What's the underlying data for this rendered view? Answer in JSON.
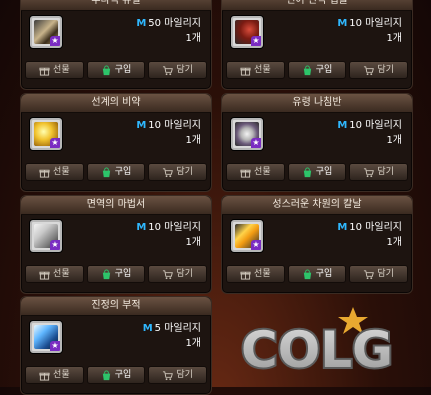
{
  "cards": [
    {
      "title": "루나틱 쥬얼",
      "price_prefix": "M",
      "price": "50 마일리지",
      "qty": "1개",
      "buttons": {
        "gift": "선물",
        "buy": "구입",
        "cart": "담기"
      }
    },
    {
      "title": "면어 면역 캡슐",
      "price_prefix": "M",
      "price": "10 마일리지",
      "qty": "1개",
      "buttons": {
        "gift": "선물",
        "buy": "구입",
        "cart": "담기"
      }
    },
    {
      "title": "선계의 비약",
      "price_prefix": "M",
      "price": "10 마일리지",
      "qty": "1개",
      "buttons": {
        "gift": "선물",
        "buy": "구입",
        "cart": "담기"
      }
    },
    {
      "title": "유령 나침반",
      "price_prefix": "M",
      "price": "10 마일리지",
      "qty": "1개",
      "buttons": {
        "gift": "선물",
        "buy": "구입",
        "cart": "담기"
      }
    },
    {
      "title": "면역의 마법서",
      "price_prefix": "M",
      "price": "10 마일리지",
      "qty": "1개",
      "buttons": {
        "gift": "선물",
        "buy": "구입",
        "cart": "담기"
      }
    },
    {
      "title": "성스러운 차원의 칼날",
      "price_prefix": "M",
      "price": "10 마일리지",
      "qty": "1개",
      "buttons": {
        "gift": "선물",
        "buy": "구입",
        "cart": "담기"
      }
    },
    {
      "title": "진정의 부적",
      "price_prefix": "M",
      "price": "5 마일리지",
      "qty": "1개",
      "buttons": {
        "gift": "선물",
        "buy": "구입",
        "cart": "담기"
      }
    }
  ],
  "watermark": {
    "text": "COLG"
  },
  "colors": {
    "accent_m": "#2fb8ff",
    "card_bg": "#1d1410",
    "title_text": "#f3eadf"
  },
  "icons": [
    "gift-icon",
    "cart-icon",
    "shopping-bag-icon",
    "item-icon"
  ]
}
